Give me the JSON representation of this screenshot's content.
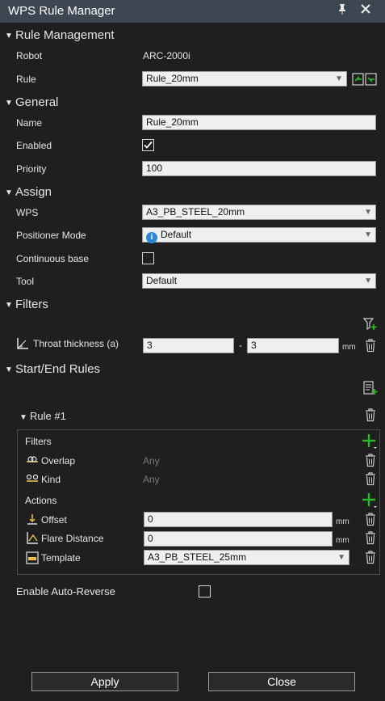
{
  "title": "WPS Rule Manager",
  "sections": {
    "rule_management": "Rule Management",
    "general": "General",
    "assign": "Assign",
    "filters": "Filters",
    "start_end": "Start/End Rules"
  },
  "rule_management": {
    "robot_label": "Robot",
    "robot_value": "ARC-2000i",
    "rule_label": "Rule",
    "rule_value": "Rule_20mm"
  },
  "general": {
    "name_label": "Name",
    "name_value": "Rule_20mm",
    "enabled_label": "Enabled",
    "enabled_checked": true,
    "priority_label": "Priority",
    "priority_value": "100"
  },
  "assign": {
    "wps_label": "WPS",
    "wps_value": "A3_PB_STEEL_20mm",
    "positioner_label": "Positioner Mode",
    "positioner_value": "Default",
    "continuous_label": "Continuous base",
    "continuous_checked": false,
    "tool_label": "Tool",
    "tool_value": "Default"
  },
  "filters": {
    "throat_label": "Throat thickness (a)",
    "throat_min": "3",
    "throat_max": "3",
    "dash": "-",
    "unit": "mm"
  },
  "rule1": {
    "title": "Rule #1",
    "filters_label": "Filters",
    "overlap_label": "Overlap",
    "overlap_value": "Any",
    "kind_label": "Kind",
    "kind_value": "Any",
    "actions_label": "Actions",
    "offset_label": "Offset",
    "offset_value": "0",
    "flare_label": "Flare Distance",
    "flare_value": "0",
    "template_label": "Template",
    "template_value": "A3_PB_STEEL_25mm",
    "unit": "mm"
  },
  "auto_reverse_label": "Enable Auto-Reverse",
  "auto_reverse_checked": false,
  "buttons": {
    "apply": "Apply",
    "close": "Close"
  },
  "colors": {
    "titlebar": "#3d4751",
    "background": "#1f1f1f",
    "accent_green": "#2bb52b",
    "info_blue": "#2d86d6"
  }
}
